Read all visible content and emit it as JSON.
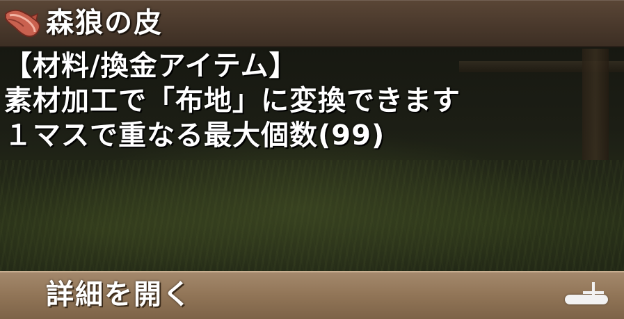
{
  "item": {
    "icon": "wolf-pelt-icon",
    "name": "森狼の皮",
    "category": "【材料/換金アイテム】",
    "description": [
      "素材加工で「布地」に変換できます",
      "１マスで重なる最大個数(99)"
    ]
  },
  "detail_bar": {
    "label": "詳細を開く",
    "expand_icon": "plus-icon"
  },
  "colors": {
    "title_bar": "#4a392c",
    "detail_bar": "#927658",
    "text": "#ffffff",
    "icon_pelt": "#d06a5a"
  }
}
